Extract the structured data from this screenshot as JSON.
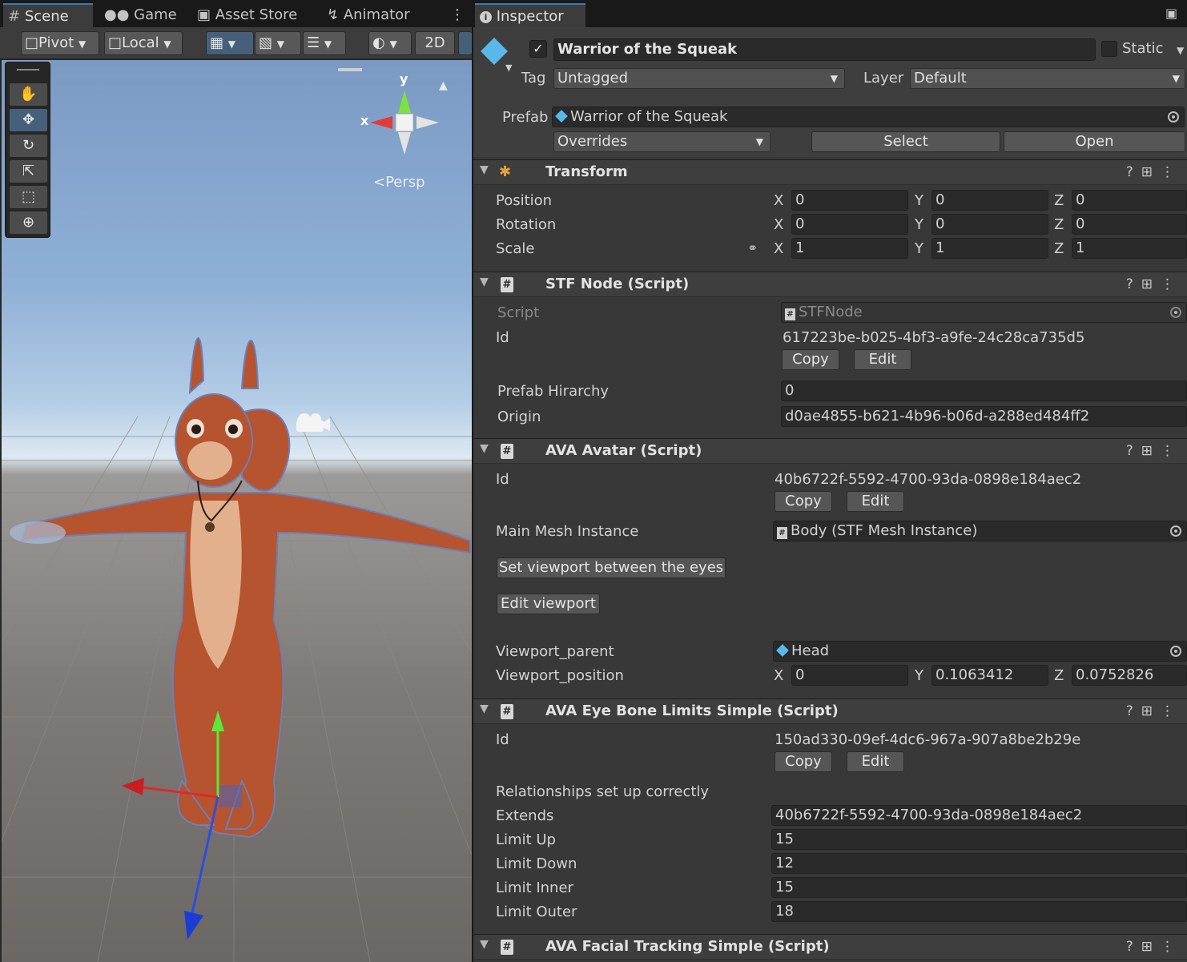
{
  "scene_tabs": {
    "scene": "Scene",
    "game": "Game",
    "asset_store": "Asset Store",
    "animator": "Animator"
  },
  "scene_toolbar": {
    "pivot": "Pivot",
    "local": "Local",
    "mode_2d": "2D"
  },
  "gizmo": {
    "y": "y",
    "x": "x",
    "persp": "Persp"
  },
  "inspector": {
    "tab": "Inspector",
    "object_name": "Warrior of the Squeak",
    "active_checked": true,
    "static_label": "Static",
    "tag_label": "Tag",
    "tag_value": "Untagged",
    "layer_label": "Layer",
    "layer_value": "Default",
    "prefab_label": "Prefab",
    "prefab_value": "Warrior of the Squeak",
    "overrides": "Overrides",
    "select": "Select",
    "open": "Open"
  },
  "transform": {
    "title": "Transform",
    "position_label": "Position",
    "rotation_label": "Rotation",
    "scale_label": "Scale",
    "position": {
      "x": "0",
      "y": "0",
      "z": "0"
    },
    "rotation": {
      "x": "0",
      "y": "0",
      "z": "0"
    },
    "scale": {
      "x": "1",
      "y": "1",
      "z": "1"
    },
    "axis_x": "X",
    "axis_y": "Y",
    "axis_z": "Z"
  },
  "stf_node": {
    "title": "STF Node (Script)",
    "script_label": "Script",
    "script_value": "STFNode",
    "id_label": "Id",
    "id_value": "617223be-b025-4bf3-a9fe-24c28ca735d5",
    "copy": "Copy",
    "edit": "Edit",
    "prefab_hirarchy_label": "Prefab Hirarchy",
    "prefab_hirarchy_value": "0",
    "origin_label": "Origin",
    "origin_value": "d0ae4855-b621-4b96-b06d-a288ed484ff2"
  },
  "ava_avatar": {
    "title": "AVA Avatar (Script)",
    "id_label": "Id",
    "id_value": "40b6722f-5592-4700-93da-0898e184aec2",
    "copy": "Copy",
    "edit": "Edit",
    "main_mesh_label": "Main Mesh Instance",
    "main_mesh_value": "Body (STF Mesh Instance)",
    "set_viewport": "Set viewport between the eyes",
    "edit_viewport": "Edit viewport",
    "viewport_parent_label": "Viewport_parent",
    "viewport_parent_value": "Head",
    "viewport_position_label": "Viewport_position",
    "viewport_position": {
      "x": "0",
      "y": "0.1063412",
      "z": "0.0752826"
    }
  },
  "ava_eye": {
    "title": "AVA Eye Bone Limits Simple (Script)",
    "id_label": "Id",
    "id_value": "150ad330-09ef-4dc6-967a-907a8be2b29e",
    "copy": "Copy",
    "edit": "Edit",
    "relationships": "Relationships set up correctly",
    "extends_label": "Extends",
    "extends_value": "40b6722f-5592-4700-93da-0898e184aec2",
    "limit_up_label": "Limit Up",
    "limit_up_value": "15",
    "limit_down_label": "Limit Down",
    "limit_down_value": "12",
    "limit_inner_label": "Limit Inner",
    "limit_inner_value": "15",
    "limit_outer_label": "Limit Outer",
    "limit_outer_value": "18"
  },
  "ava_facial": {
    "title": "AVA Facial Tracking Simple (Script)"
  }
}
